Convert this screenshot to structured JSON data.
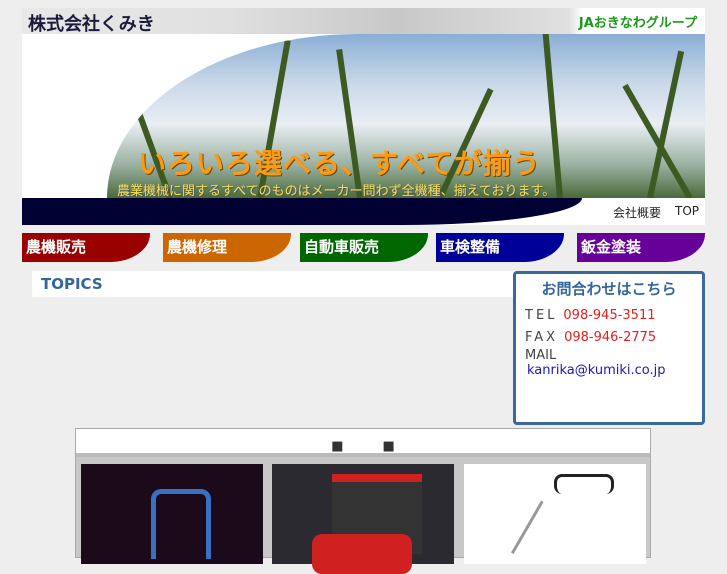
{
  "header": {
    "title": "株式会社くみき",
    "group": "JAおきなわグループ",
    "catchphrase": "いろいろ選べる、すべてが揃う",
    "subtitle": "農業機械に関するすべてのものはメーカー問わず全機種、揃えております。",
    "links": [
      "会社概要",
      "TOP"
    ]
  },
  "nav": [
    {
      "label": "農機販売",
      "color": "#990000"
    },
    {
      "label": "農機修理",
      "color": "#cc6600"
    },
    {
      "label": "自動車販売",
      "color": "#006600"
    },
    {
      "label": "車検整備",
      "color": "#000099"
    },
    {
      "label": "鈑金塗装",
      "color": "#660099"
    }
  ],
  "topics": {
    "title": "TOPICS"
  },
  "contact": {
    "title": "お問合わせはこちら",
    "tel_label": "TEL",
    "tel": "098-945-3511",
    "fax_label": "FAX",
    "fax": "098-946-2775",
    "mail_label": "MAIL",
    "mail": "kanrika@kumiki.co.jp"
  },
  "products": {
    "heading": "■　　　■"
  }
}
